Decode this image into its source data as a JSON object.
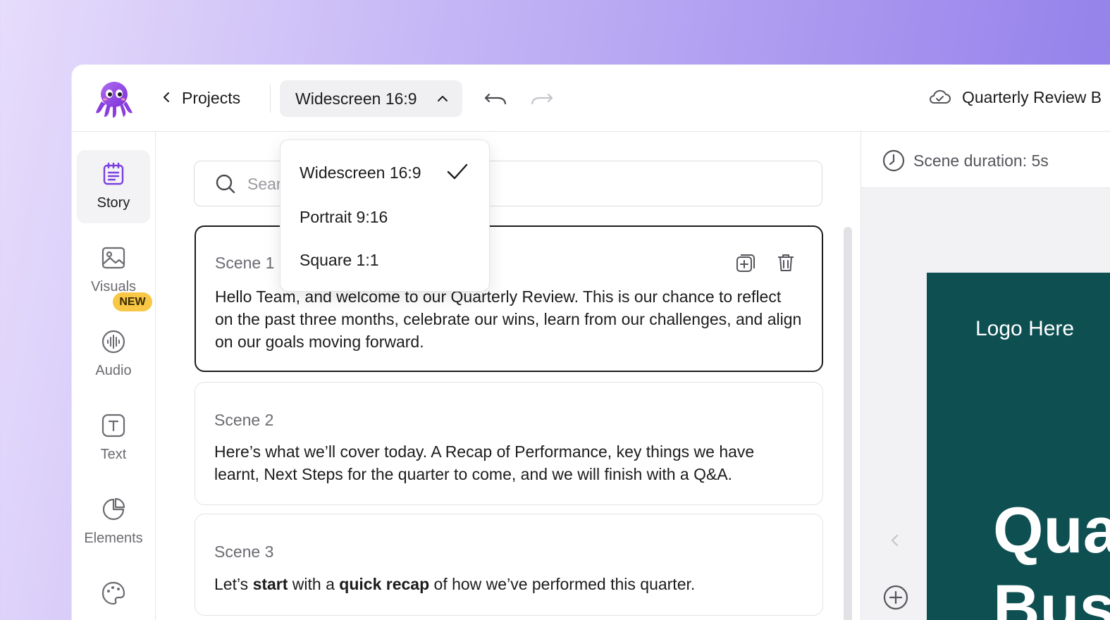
{
  "header": {
    "back_label": "Projects",
    "format_selected": "Widescreen 16:9",
    "project_title": "Quarterly Review B"
  },
  "dropdown": {
    "options": [
      "Widescreen 16:9",
      "Portrait 9:16",
      "Square 1:1"
    ],
    "selected_index": 0
  },
  "rail": {
    "items": [
      {
        "label": "Story",
        "icon": "story-icon"
      },
      {
        "label": "Visuals",
        "icon": "image-icon"
      },
      {
        "label": "Audio",
        "icon": "audio-icon"
      },
      {
        "label": "Text",
        "icon": "text-icon"
      },
      {
        "label": "Elements",
        "icon": "elements-icon"
      },
      {
        "label": "",
        "icon": "palette-icon"
      }
    ],
    "badge": "NEW"
  },
  "search": {
    "placeholder": "Search"
  },
  "scenes": [
    {
      "title": "Scene 1",
      "text": "Hello Team, and welcome to our Quarterly Review. This is our chance to reflect on the past three months, celebrate our wins, learn from our challenges, and align on our goals moving forward."
    },
    {
      "title": "Scene 2",
      "text": "Here’s what we’ll cover today. A Recap of Performance, key things we have learnt, Next Steps for the quarter to come, and we will finish with a Q&A."
    },
    {
      "title": "Scene 3",
      "text_parts": [
        "Let’s ",
        "start",
        " with a ",
        "quick recap",
        " of how we’ve performed this quarter."
      ]
    }
  ],
  "preview": {
    "duration": "Scene duration: 5s",
    "logo_text": "Logo Here",
    "headline_1": "Qua",
    "headline_2": "Bus",
    "bg_color": "#0e4f52"
  },
  "colors": {
    "accent_purple": "#8e7be9",
    "badge_yellow": "#f7c745"
  }
}
